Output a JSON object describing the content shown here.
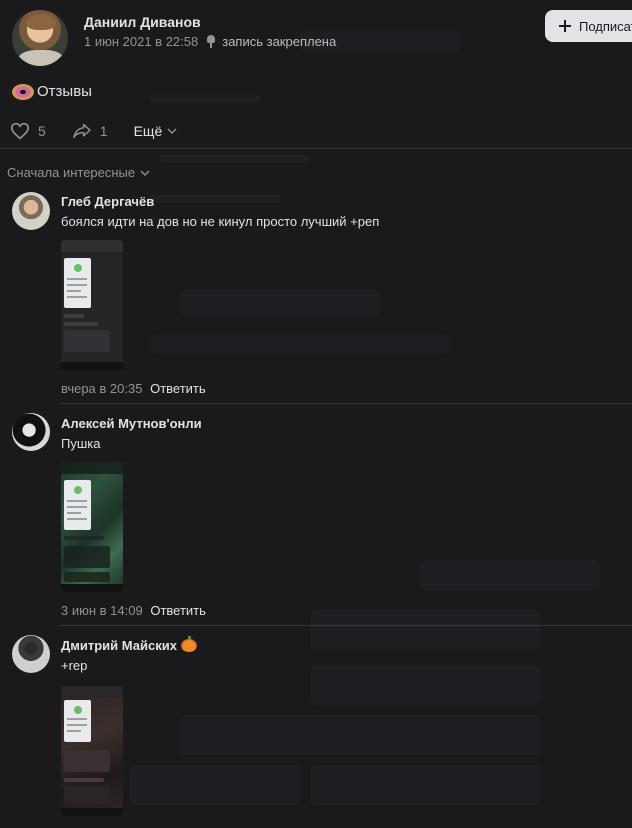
{
  "post": {
    "author": "Даниил Диванов",
    "date": "1 июн 2021 в 22:58",
    "pinned_label": "запись закреплена",
    "subscribe_label": "Подписат",
    "text": "Отзывы",
    "likes": "5",
    "shares": "1",
    "more_label": "Ещё"
  },
  "comments_sort": "Сначала интересные",
  "comments": [
    {
      "author": "Глеб Дергачёв",
      "text": "боялся идти на дов но не кинул просто лучший +реп",
      "time": "вчера в 20:35",
      "reply": "Ответить"
    },
    {
      "author": "Алексей Мутнов'онли",
      "text": "Пушка",
      "time": "3 июн в 14:09",
      "reply": "Ответить"
    },
    {
      "author": "Дмитрий Майских",
      "text": "+rep",
      "time": "",
      "reply": ""
    }
  ],
  "icons": {
    "post_icon": "donut-icon",
    "pin": "pin-icon",
    "like": "heart-icon",
    "share": "share-arrow-icon",
    "expand": "chevron-down-icon",
    "name_badge": "pumpkin-icon"
  },
  "colors": {
    "background": "#1a1a1d",
    "text_primary": "#e1e3e6",
    "text_secondary": "#939393",
    "divider": "#363738",
    "button_bg": "#e1e3e6"
  }
}
